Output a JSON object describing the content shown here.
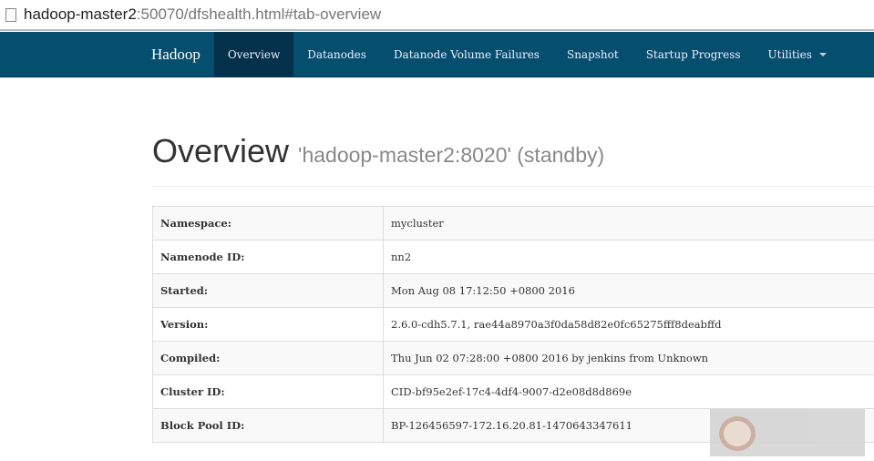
{
  "address": {
    "host": "hadoop-master2",
    "rest": ":50070/dfshealth.html#tab-overview"
  },
  "nav": {
    "brand": "Hadoop",
    "items": [
      "Overview",
      "Datanodes",
      "Datanode Volume Failures",
      "Snapshot",
      "Startup Progress",
      "Utilities"
    ]
  },
  "title": "Overview",
  "subtitle": "'hadoop-master2:8020' (standby)",
  "rows": [
    {
      "k": "Namespace:",
      "v": "mycluster"
    },
    {
      "k": "Namenode ID:",
      "v": "nn2"
    },
    {
      "k": "Started:",
      "v": "Mon Aug 08 17:12:50 +0800 2016"
    },
    {
      "k": "Version:",
      "v": "2.6.0-cdh5.7.1, rae44a8970a3f0da58d82e0fc65275fff8deabffd"
    },
    {
      "k": "Compiled:",
      "v": "Thu Jun 02 07:28:00 +0800 2016 by jenkins from Unknown"
    },
    {
      "k": "Cluster ID:",
      "v": "CID-bf95e2ef-17c4-4df4-9007-d2e08d8d869e"
    },
    {
      "k": "Block Pool ID:",
      "v": "BP-126456597-172.16.20.81-1470643347611"
    }
  ]
}
